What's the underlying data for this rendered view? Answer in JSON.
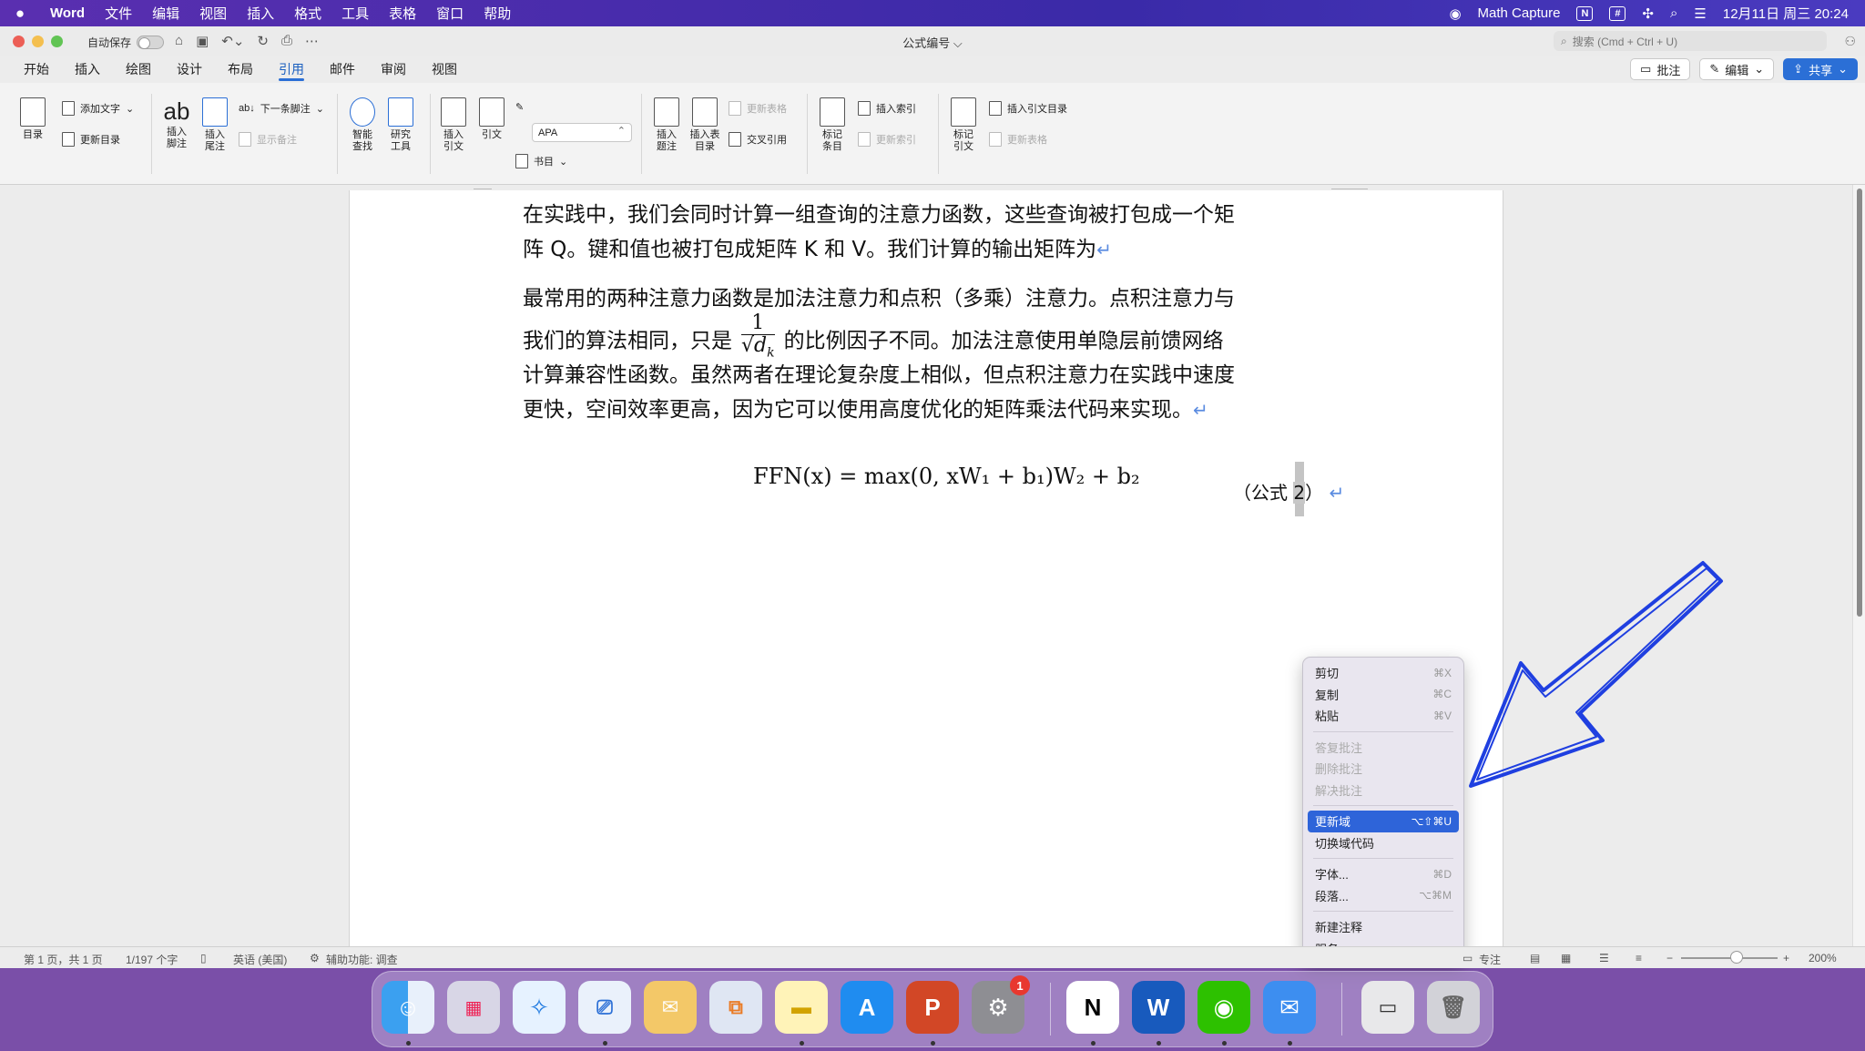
{
  "menubar": {
    "apple": "",
    "items": [
      "Word",
      "文件",
      "编辑",
      "视图",
      "插入",
      "格式",
      "工具",
      "表格",
      "窗口",
      "帮助"
    ],
    "math_capture": "Math Capture",
    "datetime": "12月11日 周三 20:24"
  },
  "titlebar": {
    "autosave_label": "自动保存",
    "doc_title": "公式编号 ⌵",
    "search_placeholder": "搜索 (Cmd + Ctrl + U)"
  },
  "tabs": {
    "items": [
      "开始",
      "插入",
      "绘图",
      "设计",
      "布局",
      "引用",
      "邮件",
      "审阅",
      "视图"
    ],
    "active": "引用",
    "comment_btn": "批注",
    "edit_btn": "编辑",
    "share_btn": "共享"
  },
  "ribbon": {
    "toc": "目录",
    "add_text": "添加文字",
    "update_toc": "更新目录",
    "insert_footnote": "插入\n脚注",
    "insert_endnote": "插入\n尾注",
    "next_footnote": "下一条脚注",
    "show_notes": "显示备注",
    "smart_lookup": "智能\n查找",
    "researcher": "研究\n工具",
    "insert_citation": "插入\n引文",
    "citation": "引文",
    "style_value": "APA",
    "bibliography": "书目",
    "insert_caption": "插入\n题注",
    "insert_table_of_figures": "插入表\n目录",
    "update_table": "更新表格",
    "cross_reference": "交叉引用",
    "mark_entry": "标记\n条目",
    "insert_index": "插入索引",
    "update_index": "更新索引",
    "mark_citation": "标记\n引文",
    "insert_toa": "插入引文目录",
    "update_toa": "更新表格"
  },
  "document": {
    "para1_line1": "在实践中，我们会同时计算一组查询的注意力函数，这些查询被打包成一个矩",
    "para1_line2": "阵 Q。键和值也被打包成矩阵 K 和 V。我们计算的输出矩阵为",
    "para2_line1": "最常用的两种注意力函数是加法注意力和点积（多乘）注意力。点积注意力与",
    "para2_line2a": "我们的算法相同，只是",
    "frac_num": "1",
    "frac_den": "√d",
    "frac_den_sub": "k",
    "para2_line2b": "的比例因子不同。加法注意使用单隐层前馈网络",
    "para2_line3": "计算兼容性函数。虽然两者在理论复杂度上相似，但点积注意力在实践中速度",
    "para2_line4": "更快，空间效率更高，因为它可以使用高度优化的矩阵乘法代码来实现。",
    "pilcrow": "↵",
    "formula": "FFN(x) = max(0, xW₁ + b₁)W₂ + b₂",
    "eq_label_prefix": "（公式 ",
    "eq_label_num": "2",
    "eq_label_suffix": "）"
  },
  "context_menu": {
    "items": [
      {
        "label": "剪切",
        "shortcut": "⌘X",
        "state": "normal"
      },
      {
        "label": "复制",
        "shortcut": "⌘C",
        "state": "normal"
      },
      {
        "label": "粘贴",
        "shortcut": "⌘V",
        "state": "normal"
      },
      {
        "label": "答复批注",
        "shortcut": "",
        "state": "disabled"
      },
      {
        "label": "删除批注",
        "shortcut": "",
        "state": "disabled"
      },
      {
        "label": "解决批注",
        "shortcut": "",
        "state": "disabled"
      },
      {
        "label": "更新域",
        "shortcut": "⌥⇧⌘U",
        "state": "selected"
      },
      {
        "label": "切换域代码",
        "shortcut": "",
        "state": "normal"
      },
      {
        "label": "字体...",
        "shortcut": "⌘D",
        "state": "normal"
      },
      {
        "label": "段落...",
        "shortcut": "⌥⌘M",
        "state": "normal"
      },
      {
        "label": "新建注释",
        "shortcut": "",
        "state": "normal"
      },
      {
        "label": "服务",
        "shortcut": "›",
        "state": "normal"
      }
    ]
  },
  "statusbar": {
    "page": "第 1 页，共 1 页",
    "words": "1/197 个字",
    "language": "英语 (美国)",
    "accessibility": "辅助功能: 调查",
    "focus": "专注",
    "zoom": "200%"
  },
  "dock": {
    "apps": [
      "finder-icon",
      "launchpad-icon",
      "safari-icon",
      "screenshot-icon",
      "preview-icon",
      "stage-manager-icon",
      "notes-icon",
      "app-store-icon",
      "powerpoint-icon",
      "system-settings-icon",
      "notion-icon",
      "word-icon",
      "wechat-icon",
      "mail-icon",
      "window-icon",
      "trash-icon"
    ],
    "settings_badge": "1",
    "word_letter": "W",
    "powerpoint_letter": "P",
    "notion_letter": "N"
  },
  "colors": {
    "accent": "#2b6fd6",
    "menu_selection": "#2e64d9",
    "annotation_arrow": "#1f3fe0"
  }
}
